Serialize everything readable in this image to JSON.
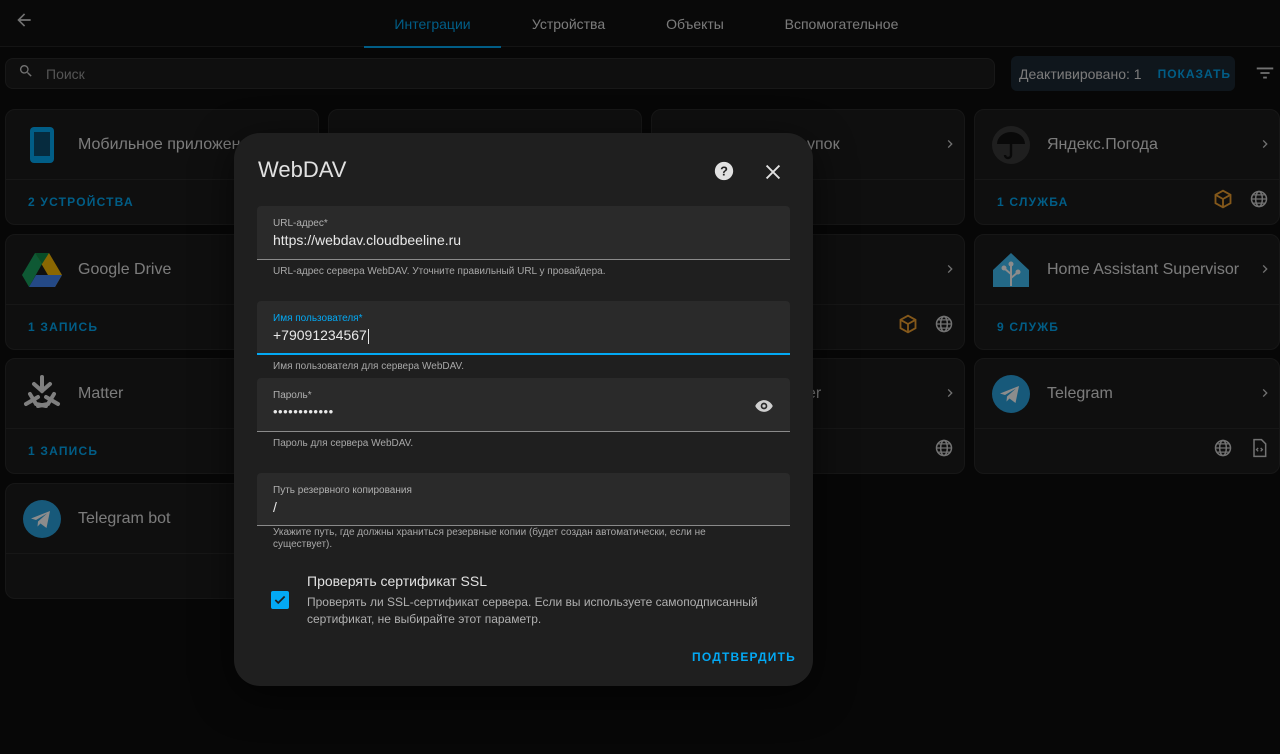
{
  "header": {
    "tabs": [
      {
        "label": "Интеграции",
        "active": true
      },
      {
        "label": "Устройства",
        "active": false
      },
      {
        "label": "Объекты",
        "active": false
      },
      {
        "label": "Вспомогательное",
        "active": false
      }
    ]
  },
  "search": {
    "placeholder": "Поиск"
  },
  "disabled": {
    "text": "Деактивировано: 1",
    "show_label": "ПОКАЗАТЬ"
  },
  "cards": [
    {
      "name": "Мобильное приложение",
      "footer": "2 УСТРОЙСТВА",
      "icon": "phone-icon"
    },
    {
      "name": "Google Drive",
      "footer": "1 ЗАПИСЬ",
      "icon": "google-drive-icon"
    },
    {
      "name": "Matter",
      "footer": "1 ЗАПИСЬ",
      "icon": "matter-icon"
    },
    {
      "name": "Telegram bot",
      "footer": "",
      "icon": "telegram-icon"
    },
    {
      "name": "упок",
      "footer": "",
      "icon": ""
    },
    {
      "name": "er",
      "footer": "",
      "icon": ""
    },
    {
      "name": "Яндекс.Погода",
      "footer": "1 СЛУЖБА",
      "icon": "umbrella-icon"
    },
    {
      "name": "Home Assistant Supervisor",
      "footer": "9 СЛУЖБ",
      "icon": "home-assistant-icon"
    },
    {
      "name": "Telegram",
      "footer": "",
      "icon": "telegram-icon"
    }
  ],
  "dialog": {
    "title": "WebDAV",
    "url": {
      "label": "URL-адрес*",
      "value": "https://webdav.cloudbeeline.ru",
      "hint": "URL-адрес сервера WebDAV. Уточните правильный URL у провайдера."
    },
    "username": {
      "label": "Имя пользователя*",
      "value": "+79091234567",
      "hint": "Имя пользователя для сервера WebDAV."
    },
    "password": {
      "label": "Пароль*",
      "value": "••••••••••••",
      "hint": "Пароль для сервера WebDAV."
    },
    "path": {
      "label": "Путь резервного копирования",
      "value": "/",
      "hint": "Укажите путь, где должны храниться резервные копии (будет создан автоматически, если не существует)."
    },
    "ssl": {
      "title": "Проверять сертификат SSL",
      "description": "Проверять ли SSL-сертификат сервера. Если вы используете самоподписанный сертификат, не выбирайте этот параметр.",
      "checked": true
    },
    "submit_label": "ПОДТВЕРДИТЬ"
  },
  "colors": {
    "accent": "#03a9f4",
    "addon_orange": "#f0a030"
  }
}
